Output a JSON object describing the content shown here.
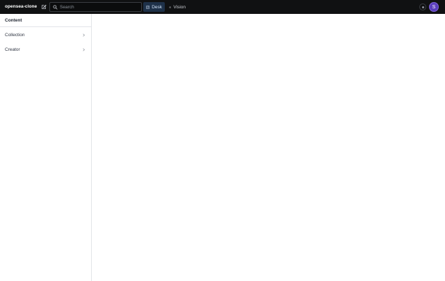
{
  "topbar": {
    "project_name": "opensea-clone",
    "compose_icon": "compose-icon",
    "search": {
      "placeholder": "Search",
      "value": "",
      "icon": "search-icon"
    },
    "tools": [
      {
        "label": "Desk",
        "icon": "desk-icon",
        "active": true
      },
      {
        "label": "Vision",
        "icon": "eye-icon",
        "active": false
      }
    ],
    "avatar_initial": "S",
    "colors": {
      "bar": "#101112",
      "active_tab": "#1e3149",
      "avatar": "#5b3ebd"
    }
  },
  "sidebar": {
    "title": "Content",
    "items": [
      {
        "label": "Collection",
        "icon": "chevron-right-icon"
      },
      {
        "label": "Creator",
        "icon": "chevron-right-icon"
      }
    ]
  }
}
